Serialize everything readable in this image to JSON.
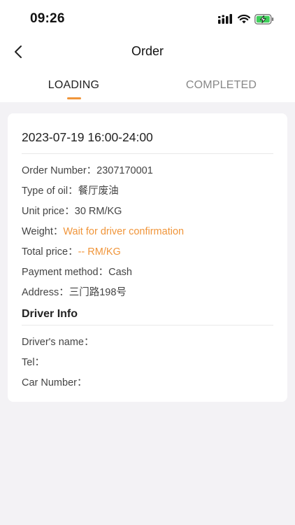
{
  "status_bar": {
    "time": "09:26",
    "icons": [
      "signal-icon",
      "wifi-icon",
      "battery-charging-icon"
    ]
  },
  "nav": {
    "title": "Order",
    "back_icon": "chevron-left-icon"
  },
  "tabs": [
    {
      "label": "LOADING",
      "active": true
    },
    {
      "label": "COMPLETED",
      "active": false
    }
  ],
  "order": {
    "date_range": "2023-07-19 16:00-24:00",
    "fields": [
      {
        "label": "Order Number：",
        "value": "2307170001"
      },
      {
        "label": "Type of oil：",
        "value": "餐厅废油"
      },
      {
        "label": "Unit price：",
        "value": "30 RM/KG"
      },
      {
        "label": "Weight：",
        "value": "Wait for driver confirmation"
      },
      {
        "label": "Total price：",
        "value": "-- RM/KG"
      },
      {
        "label": "Payment method：",
        "value": "Cash"
      },
      {
        "label": "Address：",
        "value": "三门路198号"
      }
    ]
  },
  "driver_info": {
    "title": "Driver Info",
    "fields": [
      {
        "label": "Driver's name：",
        "value": ""
      },
      {
        "label": "Tel：",
        "value": ""
      },
      {
        "label": "Car Number：",
        "value": ""
      }
    ]
  },
  "colors": {
    "accent": "#f0953a",
    "background": "#f3f2f5",
    "card": "#ffffff"
  }
}
